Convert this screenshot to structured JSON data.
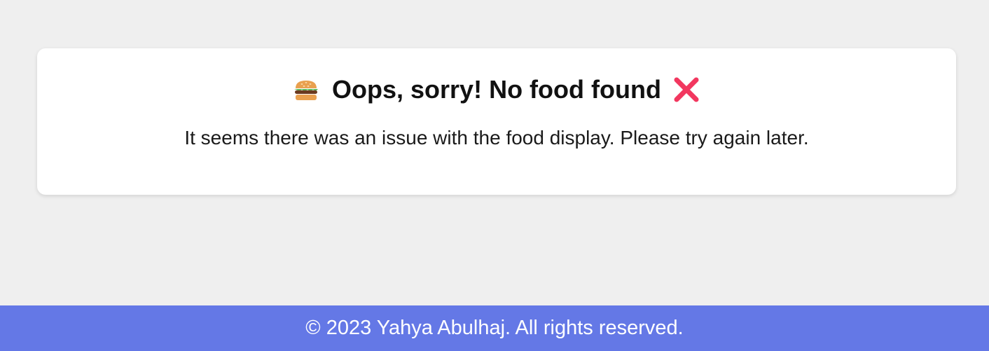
{
  "card": {
    "title": "Oops, sorry! No food found",
    "leading_icon": "burger-icon",
    "trailing_icon": "cross-icon",
    "message": "It seems there was an issue with the food display. Please try again later."
  },
  "footer": {
    "text": "© 2023 Yahya Abulhaj. All rights reserved."
  },
  "colors": {
    "page_background": "#efefef",
    "card_background": "#ffffff",
    "footer_background": "#6478e6",
    "cross_icon": "#f2375f"
  }
}
